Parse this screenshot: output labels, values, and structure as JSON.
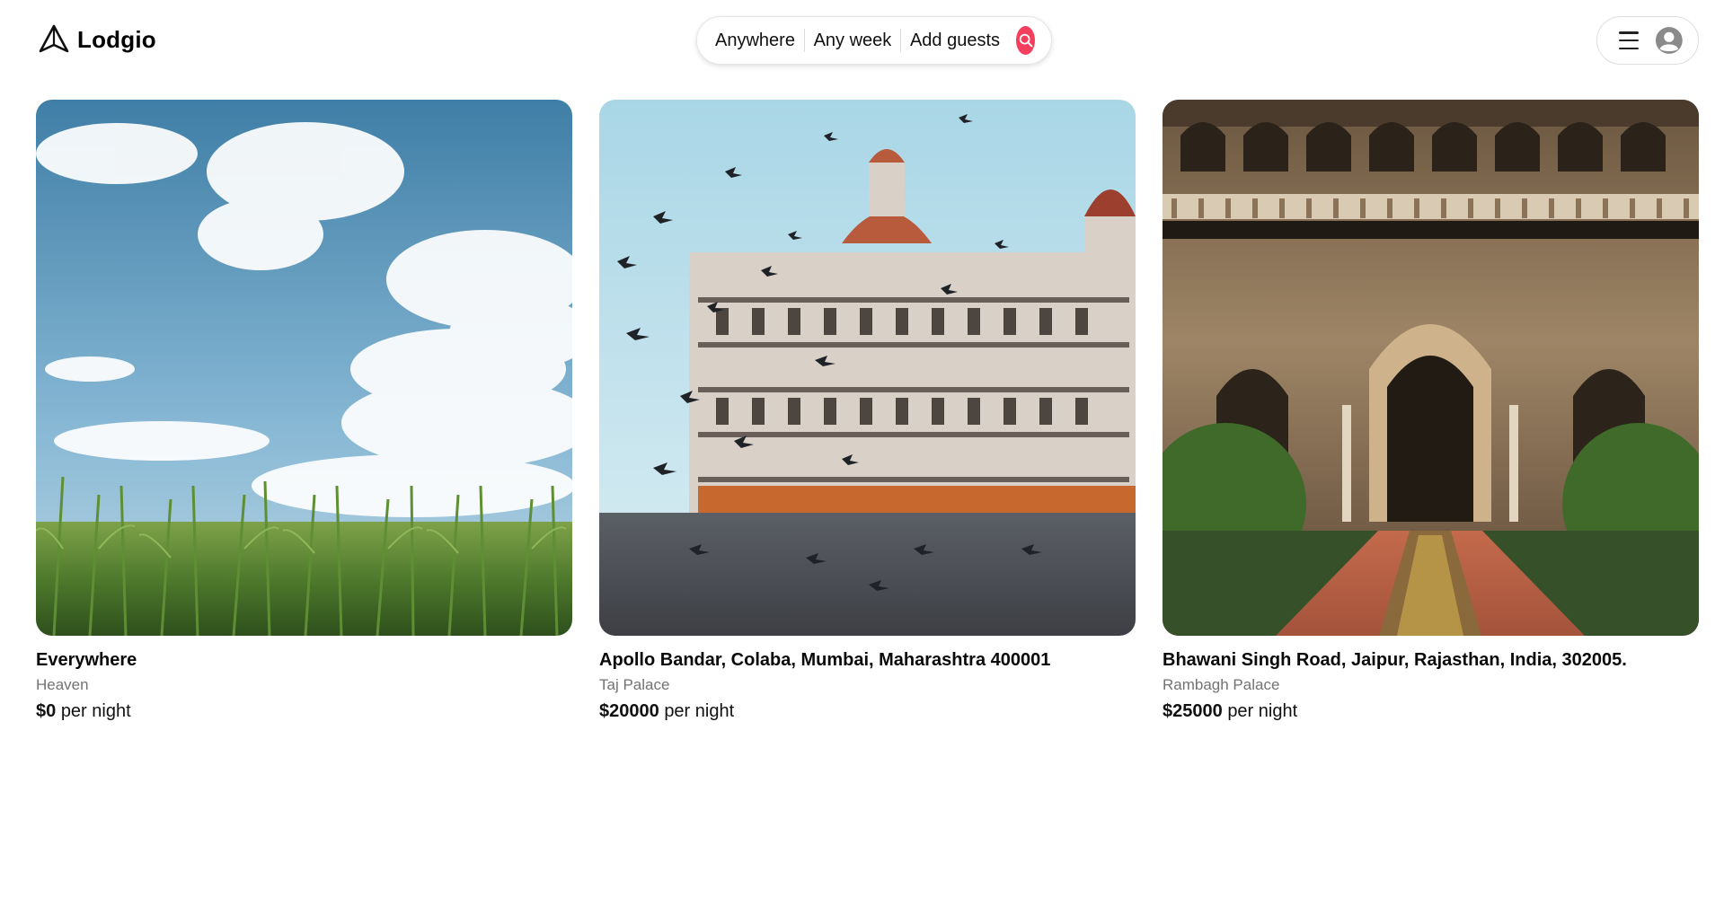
{
  "brand": {
    "name": "Lodgio"
  },
  "search": {
    "location": "Anywhere",
    "week": "Any week",
    "guests": "Add guests",
    "accent": "#f43f5e"
  },
  "icons": {
    "logo": "paper-plane-icon",
    "search": "magnifier-icon",
    "menu": "hamburger-icon",
    "avatar": "user-avatar-icon"
  },
  "listings": [
    {
      "location": "Everywhere",
      "name": "Heaven",
      "price": "$0",
      "unit": "per night",
      "photo": "sky-and-cornfield"
    },
    {
      "location": "Apollo Bandar, Colaba, Mumbai, Maharashtra 400001",
      "name": "Taj Palace",
      "price": "$20000",
      "unit": "per night",
      "photo": "palace-with-birds"
    },
    {
      "location": "Bhawani Singh Road, Jaipur, Rajasthan, India, 302005.",
      "name": "Rambagh Palace",
      "price": "$25000",
      "unit": "per night",
      "photo": "arched-courtyard"
    }
  ]
}
